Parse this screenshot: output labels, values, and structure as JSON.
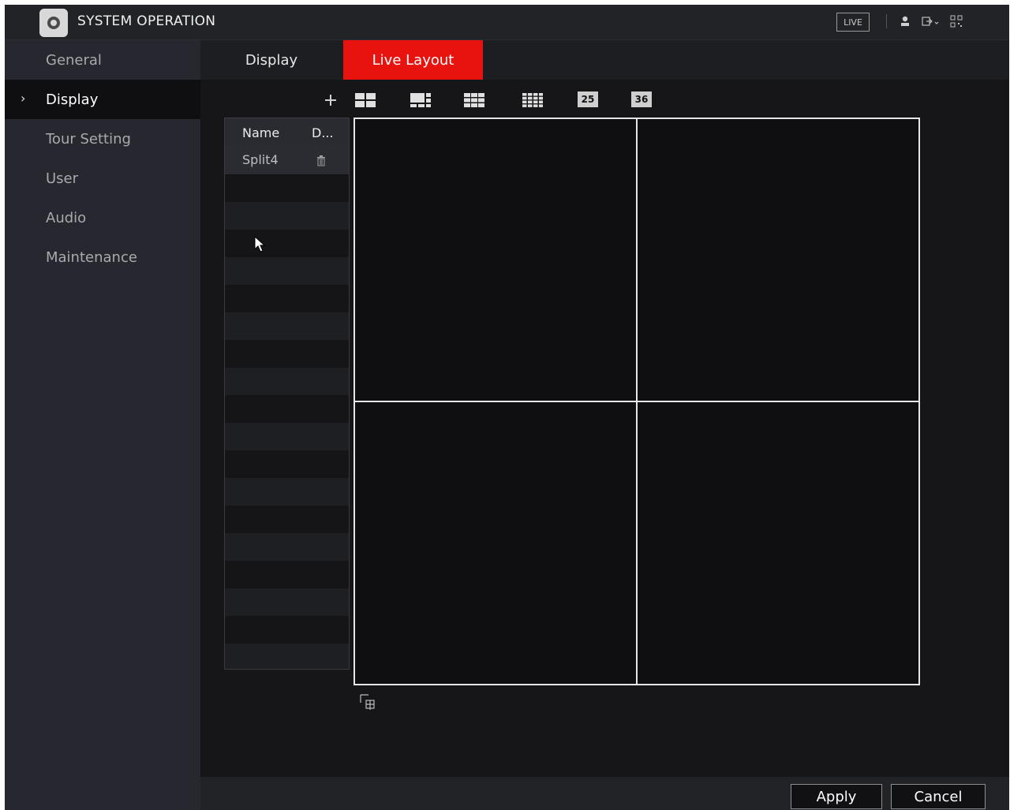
{
  "header": {
    "title": "SYSTEM OPERATION",
    "live_label": "LIVE",
    "icons": [
      "gear-icon",
      "user-icon",
      "logout-icon",
      "qr-code-icon"
    ]
  },
  "sidebar": {
    "items": [
      {
        "label": "General"
      },
      {
        "label": "Display"
      },
      {
        "label": "Tour Setting"
      },
      {
        "label": "User"
      },
      {
        "label": "Audio"
      },
      {
        "label": "Maintenance"
      }
    ],
    "active": "Display"
  },
  "tabs": [
    {
      "label": "Display"
    },
    {
      "label": "Live Layout"
    }
  ],
  "active_tab": "Live Layout",
  "toolbar": {
    "add_icon": "plus-icon",
    "layouts": [
      "split4-icon",
      "split6-icon",
      "split8-icon",
      "split9-icon",
      "25",
      "36"
    ]
  },
  "layout_list": {
    "columns": [
      "Name",
      "D..."
    ],
    "rows": [
      {
        "name": "Split4",
        "delete_icon": "trash-icon"
      }
    ]
  },
  "preview": {
    "split": 4
  },
  "footer": {
    "apply_label": "Apply",
    "cancel_label": "Cancel"
  },
  "colors": {
    "accent": "#e8130f",
    "background": "#16171b",
    "sidebar": "#26272f"
  }
}
